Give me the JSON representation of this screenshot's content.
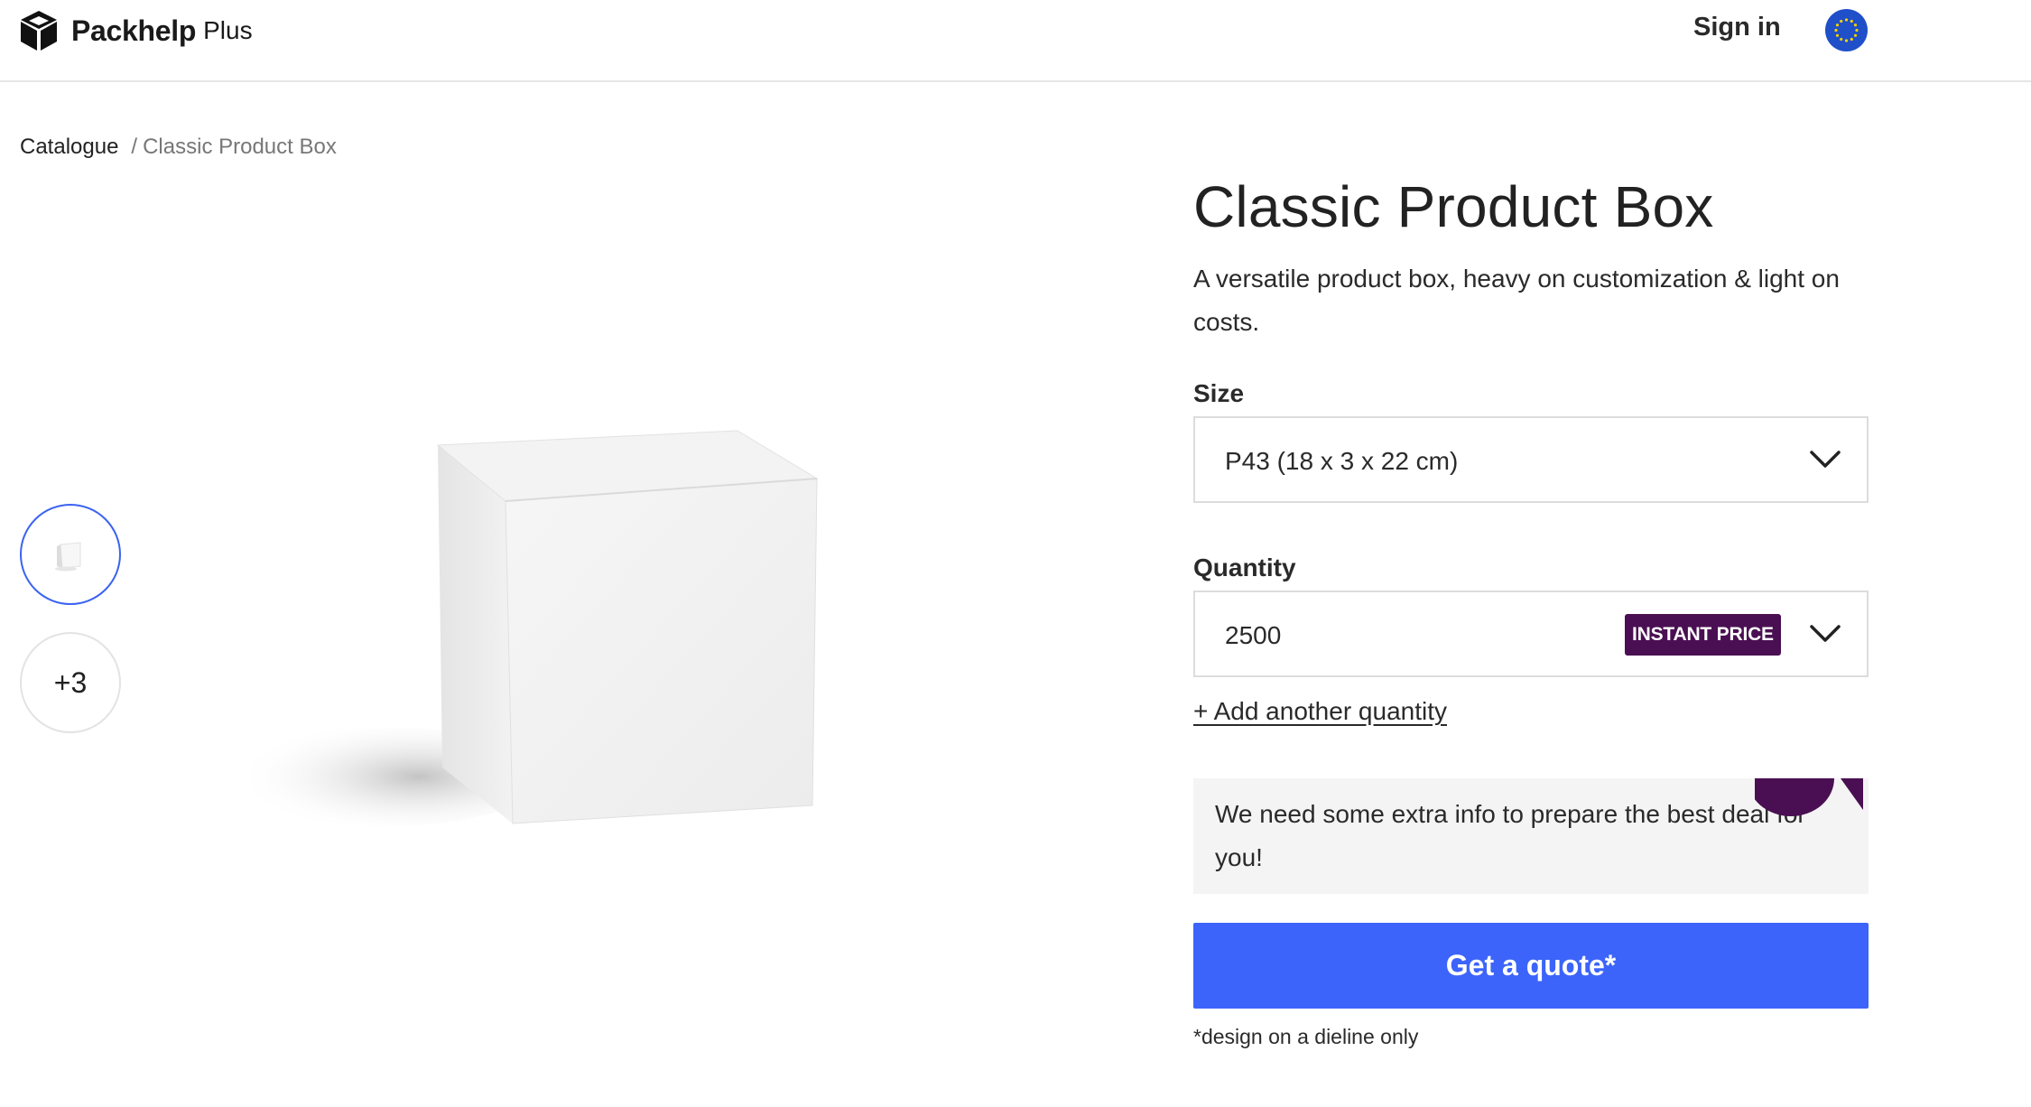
{
  "header": {
    "brand_name": "Packhelp",
    "brand_suffix": "Plus",
    "sign_in_label": "Sign in",
    "region_icon": "eu-flag-icon"
  },
  "breadcrumb": {
    "items": [
      "Catalogue"
    ],
    "separator": "/",
    "current": "Classic Product Box"
  },
  "gallery": {
    "more_count_label": "+3"
  },
  "product": {
    "title": "Classic Product Box",
    "description": "A versatile product box, heavy on customization & light on costs."
  },
  "size": {
    "label": "Size",
    "selected": "P43 (18 x 3 x 22 cm)"
  },
  "quantity": {
    "label": "Quantity",
    "selected": "2500",
    "badge": "INSTANT PRICE",
    "add_another_label": "+ Add another quantity"
  },
  "info": {
    "message": "We need some extra info to prepare the best deal for you!"
  },
  "cta": {
    "quote_label": "Get a quote*",
    "footnote": "*design on a dieline only"
  },
  "colors": {
    "accent_blue": "#3c64fa",
    "badge_purple": "#4a0f52",
    "thumb_active_border": "#3a63f0"
  }
}
